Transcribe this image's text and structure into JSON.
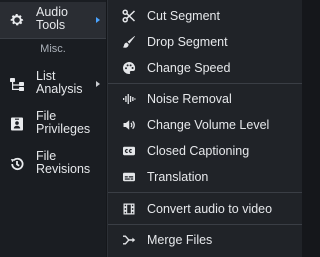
{
  "sidebar": {
    "items": [
      {
        "label": "Audio\nTools",
        "icon": "gear-icon"
      },
      {
        "label": "List\nAnalysis",
        "icon": "hierarchy-icon"
      },
      {
        "label": "File\nPrivileges",
        "icon": "badge-icon"
      },
      {
        "label": "File\nRevisions",
        "icon": "history-icon"
      }
    ],
    "section_label": "Misc."
  },
  "submenu": {
    "items": [
      {
        "label": "Cut Segment",
        "icon": "scissors-icon"
      },
      {
        "label": "Drop Segment",
        "icon": "brush-icon"
      },
      {
        "label": "Change Speed",
        "icon": "palette-icon"
      },
      {
        "label": "Noise Removal",
        "icon": "waveform-icon"
      },
      {
        "label": "Change Volume Level",
        "icon": "volume-icon"
      },
      {
        "label": "Closed Captioning",
        "icon": "cc-icon"
      },
      {
        "label": "Translation",
        "icon": "subtitles-icon"
      },
      {
        "label": "Convert audio to video",
        "icon": "film-icon"
      },
      {
        "label": "Merge Files",
        "icon": "merge-icon"
      }
    ]
  },
  "colors": {
    "accent": "#4aa3ff",
    "background": "#15171b",
    "menu_bg": "#202328"
  }
}
